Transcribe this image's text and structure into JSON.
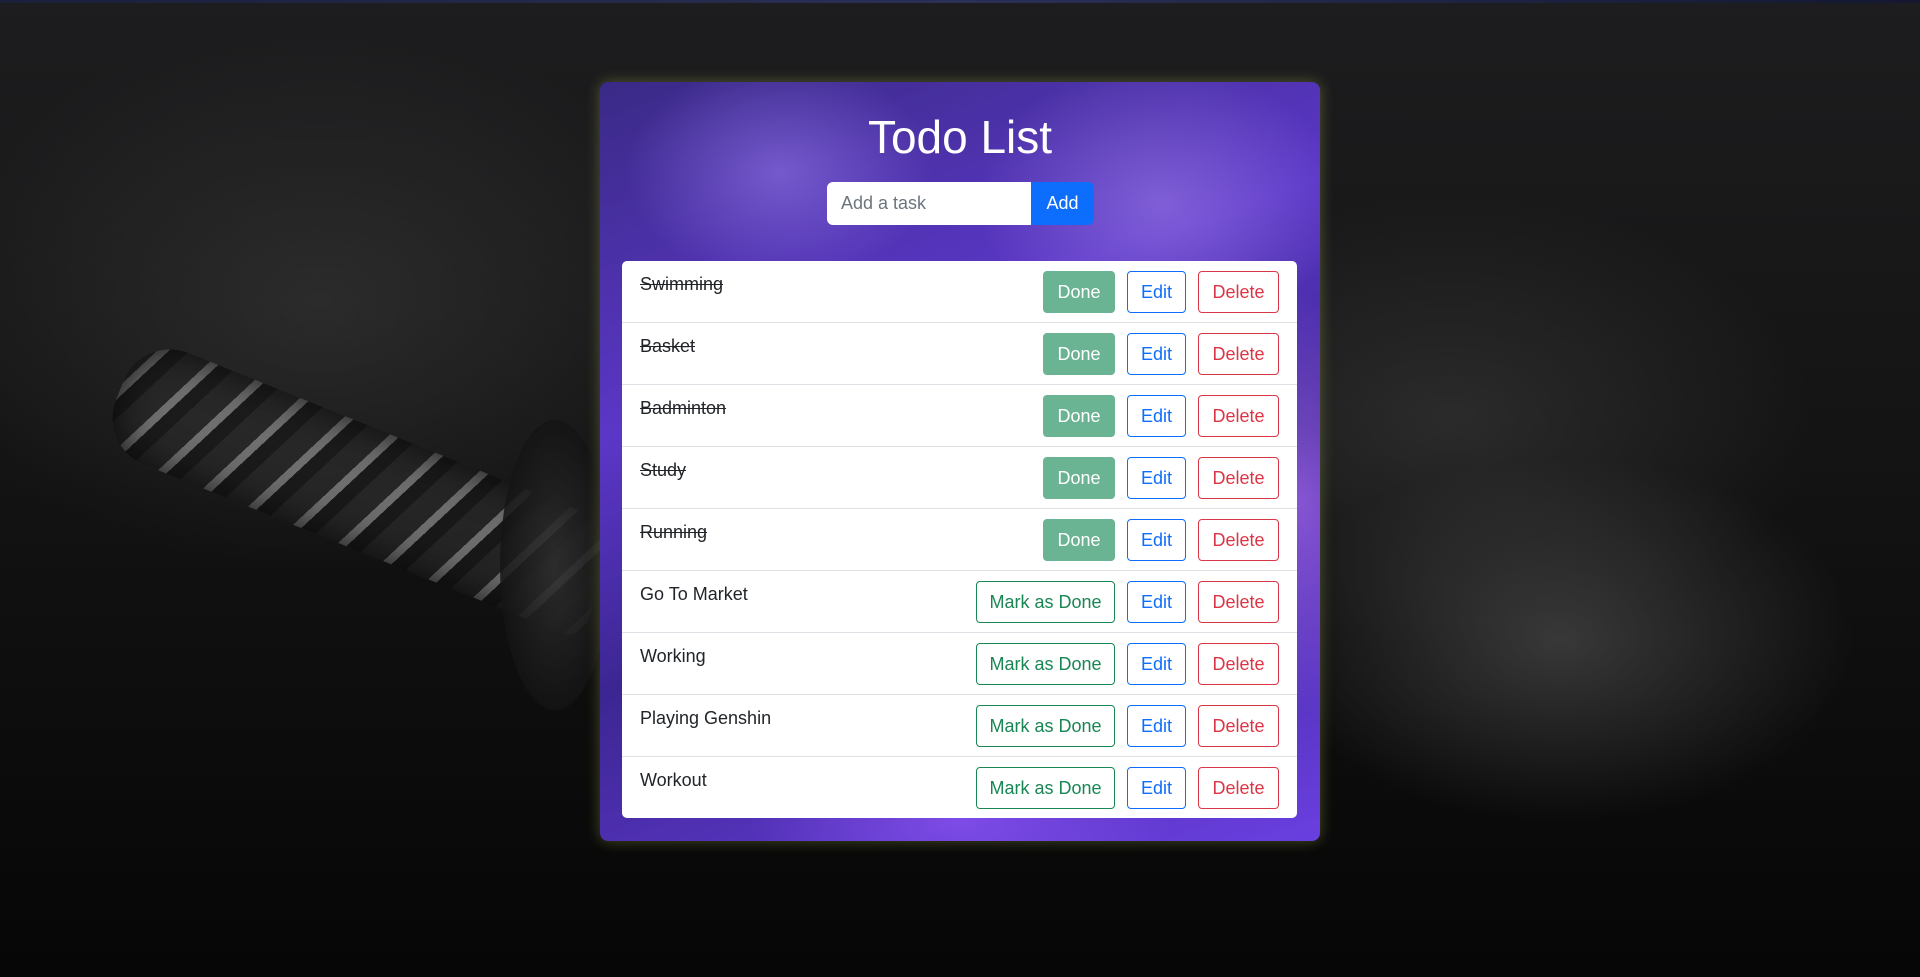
{
  "app": {
    "title": "Todo List"
  },
  "form": {
    "placeholder": "Add a task",
    "value": "",
    "add_label": "Add"
  },
  "labels": {
    "done": "Done",
    "mark_done": "Mark as Done",
    "edit": "Edit",
    "delete": "Delete"
  },
  "tasks": [
    {
      "text": "Swimming",
      "done": true
    },
    {
      "text": "Basket",
      "done": true
    },
    {
      "text": "Badminton",
      "done": true
    },
    {
      "text": "Study",
      "done": true
    },
    {
      "text": "Running",
      "done": true
    },
    {
      "text": "Go To Market",
      "done": false
    },
    {
      "text": "Working",
      "done": false
    },
    {
      "text": "Playing Genshin",
      "done": false
    },
    {
      "text": "Workout",
      "done": false
    }
  ],
  "colors": {
    "primary": "#0d6efd",
    "success": "#198754",
    "done_fill": "#6bb493",
    "danger": "#dc3545",
    "card_purple": "#5b37c7"
  }
}
